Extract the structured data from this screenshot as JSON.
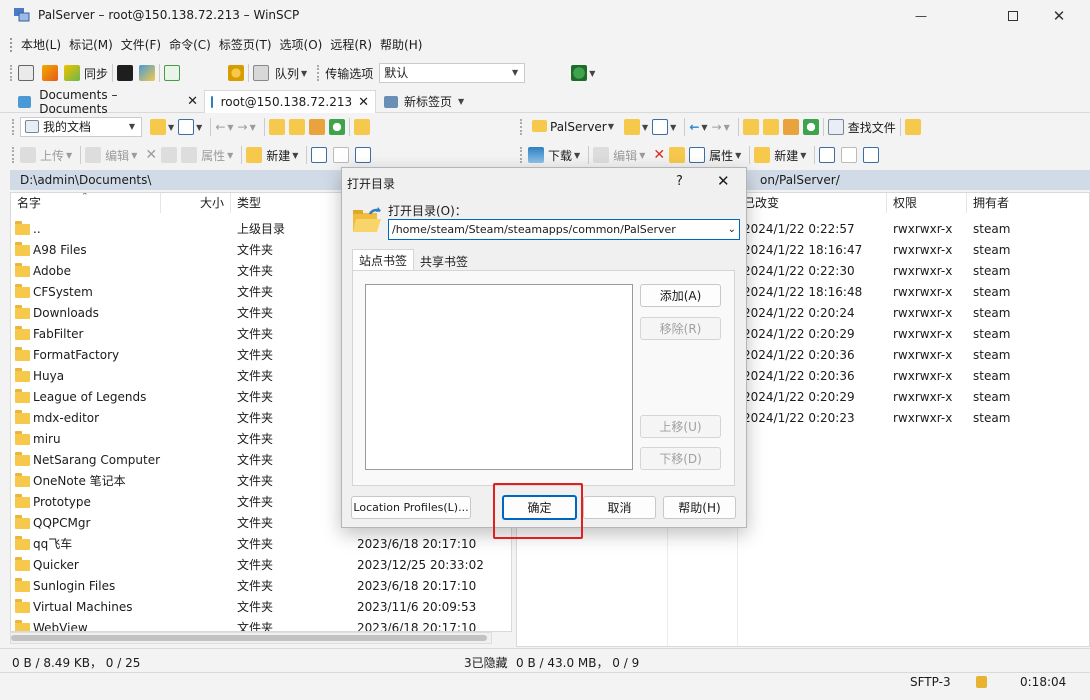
{
  "window": {
    "title": "PalServer – root@150.138.72.213 – WinSCP"
  },
  "menu": [
    "本地(L)",
    "标记(M)",
    "文件(F)",
    "命令(C)",
    "标签页(T)",
    "选项(O)",
    "远程(R)",
    "帮助(H)"
  ],
  "toolbar1": {
    "sync_label": "同步",
    "queue_label": "队列",
    "transfer_label": "传输选项",
    "transfer_value": "默认"
  },
  "tabs": [
    {
      "label": "Documents – Documents"
    },
    {
      "label": "root@150.138.72.213"
    },
    {
      "label": "新标签页"
    }
  ],
  "left": {
    "location": "我的文档",
    "upload": "上传",
    "edit": "编辑",
    "props": "属性",
    "new": "新建",
    "path": "D:\\admin\\Documents\\",
    "columns": {
      "name": "名字",
      "size": "大小",
      "type": "类型"
    },
    "files": [
      {
        "name": "..",
        "type": "上级目录",
        "date": ""
      },
      {
        "name": "A98 Files",
        "type": "文件夹",
        "date": ""
      },
      {
        "name": "Adobe",
        "type": "文件夹",
        "date": ""
      },
      {
        "name": "CFSystem",
        "type": "文件夹",
        "date": ""
      },
      {
        "name": "Downloads",
        "type": "文件夹",
        "date": ""
      },
      {
        "name": "FabFilter",
        "type": "文件夹",
        "date": ""
      },
      {
        "name": "FormatFactory",
        "type": "文件夹",
        "date": ""
      },
      {
        "name": "Huya",
        "type": "文件夹",
        "date": ""
      },
      {
        "name": "League of Legends",
        "type": "文件夹",
        "date": ""
      },
      {
        "name": "mdx-editor",
        "type": "文件夹",
        "date": ""
      },
      {
        "name": "miru",
        "type": "文件夹",
        "date": ""
      },
      {
        "name": "NetSarang Computer",
        "type": "文件夹",
        "date": ""
      },
      {
        "name": "OneNote 笔记本",
        "type": "文件夹",
        "date": ""
      },
      {
        "name": "Prototype",
        "type": "文件夹",
        "date": ""
      },
      {
        "name": "QQPCMgr",
        "type": "文件夹",
        "date": ""
      },
      {
        "name": "qq飞车",
        "type": "文件夹",
        "date": "2023/6/18 20:17:10"
      },
      {
        "name": "Quicker",
        "type": "文件夹",
        "date": "2023/12/25 20:33:02"
      },
      {
        "name": "Sunlogin Files",
        "type": "文件夹",
        "date": "2023/6/18 20:17:10"
      },
      {
        "name": "Virtual Machines",
        "type": "文件夹",
        "date": "2023/11/6 20:09:53"
      },
      {
        "name": "WebView",
        "type": "文件夹",
        "date": "2023/6/18 20:17:10"
      }
    ],
    "status": "0 B / 8.49 KB， 0 / 25",
    "hidden": "3已隐藏"
  },
  "right": {
    "location": "PalServer",
    "download": "下载",
    "edit": "编辑",
    "props": "属性",
    "new": "新建",
    "find": "查找文件",
    "path_partial": "on/PalServer/",
    "columns": {
      "changed": "已改变",
      "rights": "权限",
      "owner": "拥有者"
    },
    "files": [
      {
        "changed": "2024/1/22 0:22:57",
        "rights": "rwxrwxr-x",
        "owner": "steam"
      },
      {
        "changed": "2024/1/22 18:16:47",
        "rights": "rwxrwxr-x",
        "owner": "steam"
      },
      {
        "changed": "2024/1/22 0:22:30",
        "rights": "rwxrwxr-x",
        "owner": "steam"
      },
      {
        "changed": "2024/1/22 18:16:48",
        "rights": "rwxrwxr-x",
        "owner": "steam"
      },
      {
        "changed": "2024/1/22 0:20:24",
        "rights": "rwxrwxr-x",
        "owner": "steam"
      },
      {
        "changed": "2024/1/22 0:20:29",
        "rights": "rwxrwxr-x",
        "owner": "steam"
      },
      {
        "changed": "2024/1/22 0:20:36",
        "rights": "rwxrwxr-x",
        "owner": "steam"
      },
      {
        "changed": "2024/1/22 0:20:36",
        "rights": "rwxrwxr-x",
        "owner": "steam"
      },
      {
        "changed": "2024/1/22 0:20:29",
        "rights": "rwxrwxr-x",
        "owner": "steam"
      },
      {
        "changed": "2024/1/22 0:20:23",
        "rights": "rwxrwxr-x",
        "owner": "steam"
      }
    ],
    "status": "0 B / 43.0 MB， 0 / 9"
  },
  "statusbar": {
    "protocol": "SFTP-3",
    "time": "0:18:04"
  },
  "dialog": {
    "title": "打开目录",
    "help_glyph": "?",
    "label": "打开目录(O)：",
    "path_value": "/home/steam/Steam/steamapps/common/PalServer",
    "tab_site": "站点书签",
    "tab_shared": "共享书签",
    "add": "添加(A)",
    "remove": "移除(R)",
    "up": "上移(U)",
    "down": "下移(D)",
    "profiles": "Location Profiles(L)...",
    "ok": "确定",
    "cancel": "取消",
    "help": "帮助(H)"
  },
  "colors": {
    "accent": "#0067c0",
    "highlight": "#e02020",
    "pathbar": "#d1dbe7",
    "folder": "#f6c94c"
  }
}
